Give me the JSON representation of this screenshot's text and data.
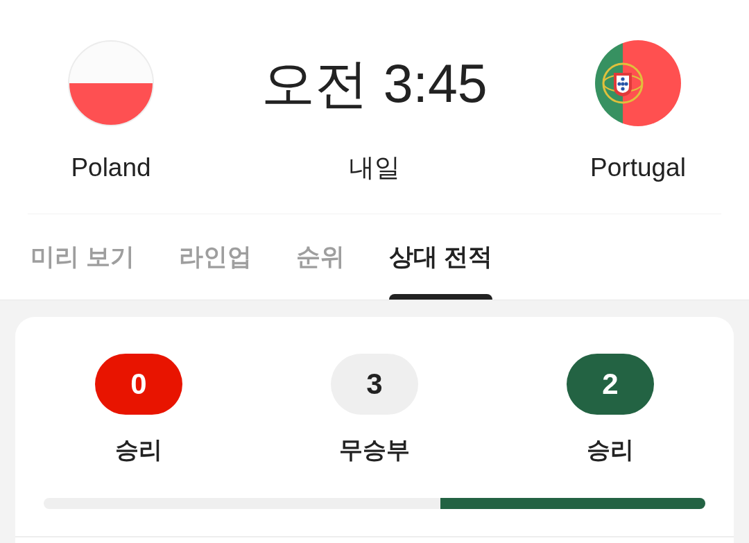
{
  "match": {
    "home": {
      "name": "Poland"
    },
    "time": "오전 3:45",
    "day": "내일",
    "away": {
      "name": "Portugal"
    }
  },
  "tabs": [
    {
      "label": "미리 보기",
      "selected": false
    },
    {
      "label": "라인업",
      "selected": false
    },
    {
      "label": "순위",
      "selected": false
    },
    {
      "label": "상대 전적",
      "selected": true
    }
  ],
  "head_to_head": {
    "record": [
      {
        "count": "0",
        "label": "승리",
        "color": "#e81400"
      },
      {
        "count": "3",
        "label": "무승부",
        "color": "#efefef"
      },
      {
        "count": "2",
        "label": "승리",
        "color": "#236343"
      }
    ],
    "bar": {
      "level": 0.4
    }
  }
}
